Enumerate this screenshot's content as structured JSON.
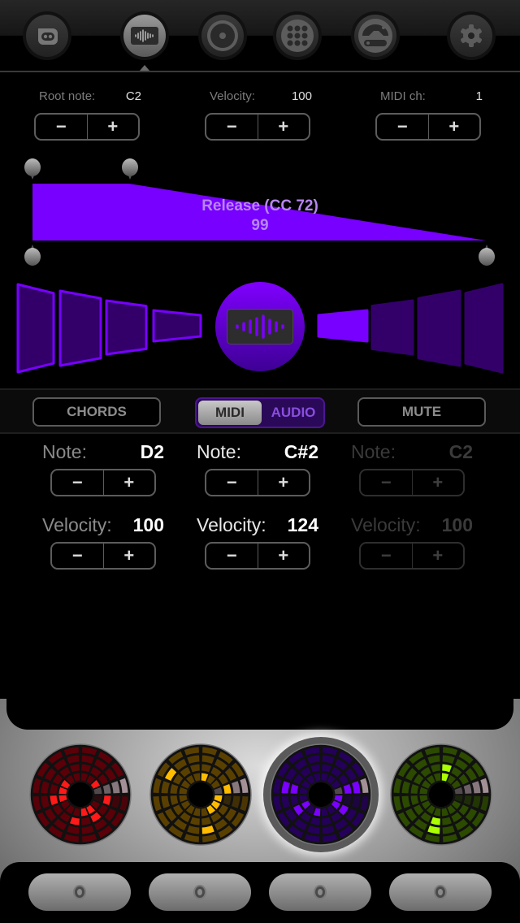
{
  "toolbar": {
    "items": [
      {
        "name": "kit-browser",
        "icon": "robot-face-icon",
        "active": false
      },
      {
        "name": "sound-editor",
        "icon": "waveform-icon",
        "active": true
      },
      {
        "name": "record",
        "icon": "record-disc-icon",
        "active": false
      },
      {
        "name": "pad-grid",
        "icon": "grid-dots-icon",
        "active": false
      },
      {
        "name": "mixer",
        "icon": "gauge-slider-icon",
        "active": false
      },
      {
        "name": "settings",
        "icon": "gear-icon",
        "active": false
      }
    ]
  },
  "global_params": [
    {
      "label": "Root note:",
      "value": "C2"
    },
    {
      "label": "Velocity:",
      "value": "100"
    },
    {
      "label": "MIDI ch:",
      "value": "1"
    }
  ],
  "stepper": {
    "minus": "−",
    "plus": "+"
  },
  "envelope": {
    "label": "Release (CC 72)",
    "value": "99",
    "fill_color": "#7700ff",
    "points": [
      {
        "x": 0.0,
        "y": 1.0
      },
      {
        "x": 0.213,
        "y": 1.0
      },
      {
        "x": 1.0,
        "y": 0.0
      }
    ]
  },
  "segments": {
    "left_count": 4,
    "right_count": 4,
    "active_right_index": 0,
    "center_icon": "waveform-icon",
    "active_color": "#7700ff",
    "inactive_color": "#33006a"
  },
  "mode_bar": {
    "chords": "CHORDS",
    "midi": "MIDI",
    "audio": "AUDIO",
    "selected": "MIDI",
    "mute": "MUTE"
  },
  "note_columns": [
    {
      "note_label": "Note:",
      "note": "D2",
      "vel_label": "Velocity:",
      "velocity": "100",
      "state": "normal"
    },
    {
      "note_label": "Note:",
      "note": "C#2",
      "vel_label": "Velocity:",
      "velocity": "124",
      "state": "active"
    },
    {
      "note_label": "Note:",
      "note": "C2",
      "vel_label": "Velocity:",
      "velocity": "100",
      "state": "disabled"
    }
  ],
  "pads": [
    {
      "name": "red",
      "base": "#5a0008",
      "lit": "#ff1a1a",
      "selected": false
    },
    {
      "name": "amber",
      "base": "#5a4000",
      "lit": "#ffbb00",
      "selected": false
    },
    {
      "name": "purple",
      "base": "#24005a",
      "lit": "#7a00ff",
      "selected": true
    },
    {
      "name": "green",
      "base": "#2c4a00",
      "lit": "#aaff00",
      "selected": false
    }
  ],
  "bottom_buttons": 4
}
